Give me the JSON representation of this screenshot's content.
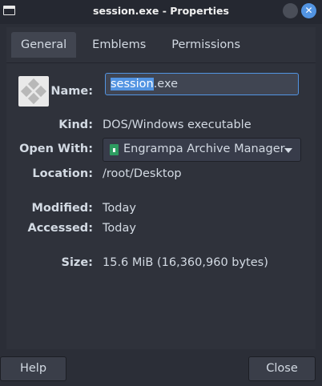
{
  "window": {
    "title": "session.exe - Properties"
  },
  "tabs": [
    {
      "label": "General",
      "active": true
    },
    {
      "label": "Emblems",
      "active": false
    },
    {
      "label": "Permissions",
      "active": false
    }
  ],
  "general": {
    "name_label": "Name:",
    "name_selected": "session",
    "name_rest": ".exe",
    "kind_label": "Kind:",
    "kind_value": "DOS/Windows executable",
    "openwith_label": "Open With:",
    "openwith_value": "Engrampa Archive Manager",
    "location_label": "Location:",
    "location_value": "/root/Desktop",
    "modified_label": "Modified:",
    "modified_value": "Today",
    "accessed_label": "Accessed:",
    "accessed_value": "Today",
    "size_label": "Size:",
    "size_value": "15.6 MiB (16,360,960 bytes)"
  },
  "footer": {
    "help_label": "Help",
    "close_label": "Close"
  },
  "colors": {
    "accent": "#5294e2",
    "background": "#2b2e37",
    "app_icon": "#2e9c61"
  }
}
